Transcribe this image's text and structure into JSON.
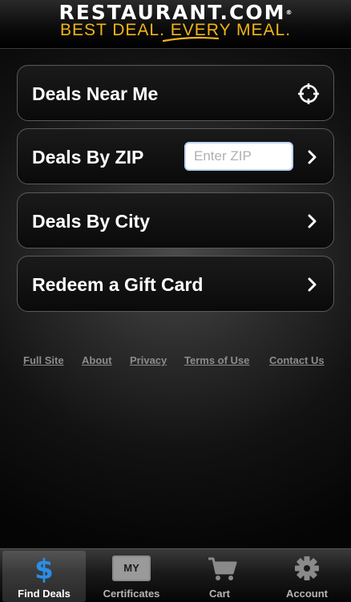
{
  "header": {
    "logo_top": "RESTAURANT.COM",
    "logo_registered": "®",
    "tagline": "BEST DEAL. EVERY MEAL."
  },
  "menu": {
    "deals_near_me": "Deals Near Me",
    "deals_by_zip": "Deals By ZIP",
    "zip_placeholder": "Enter ZIP",
    "deals_by_city": "Deals By City",
    "redeem_gift_card": "Redeem a Gift Card"
  },
  "footer_links": {
    "full_site": "Full Site",
    "about": "About",
    "privacy": "Privacy",
    "terms": "Terms of Use",
    "contact": "Contact Us"
  },
  "tabs": {
    "find_deals": "Find Deals",
    "certificates": "Certificates",
    "certificates_icon_text": "MY",
    "cart": "Cart",
    "account": "Account",
    "active": "Find Deals"
  },
  "colors": {
    "tagline": "#f2b415",
    "dollar_icon": "#2a8ee8",
    "footer_link": "#8c8c8c"
  }
}
